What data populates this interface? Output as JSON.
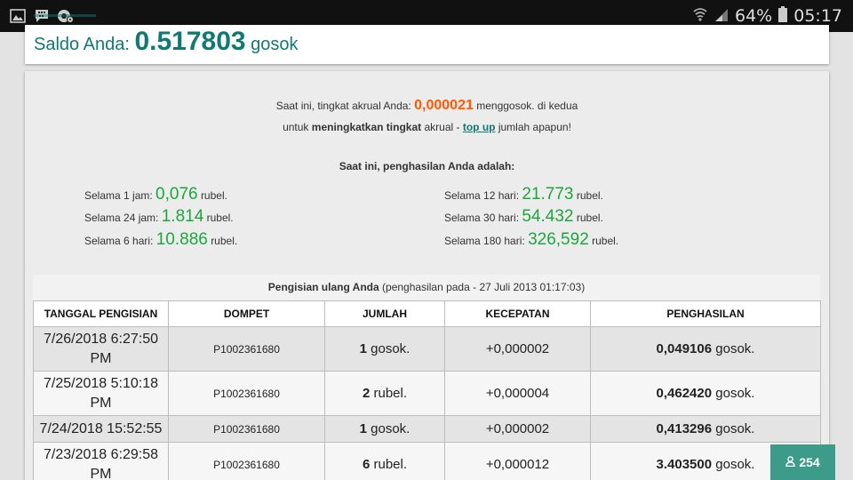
{
  "status_bar": {
    "battery": "64%",
    "time": "05:17"
  },
  "balance": {
    "label": "Saldo Anda:",
    "amount": "0.517803",
    "unit": "gosok"
  },
  "accrual": {
    "line1_prefix": "Saat ini, tingkat akrual Anda:",
    "rate": "0,000021",
    "line1_suffix": "menggosok. di kedua",
    "line2_prefix": "untuk",
    "line2_bold": "meningkatkan tingkat",
    "line2_mid": "akrual -",
    "line2_link": "top up",
    "line2_suffix": "jumlah apapun!"
  },
  "earnings": {
    "heading": "Saat ini, penghasilan Anda adalah:",
    "unit": "rubel.",
    "items": [
      {
        "label": "Selama 1 jam:",
        "value": "0,076"
      },
      {
        "label": "Selama 24 jam:",
        "value": "1.814"
      },
      {
        "label": "Selama 6 hari:",
        "value": "10.886"
      },
      {
        "label": "Selama 12 hari:",
        "value": "21.773"
      },
      {
        "label": "Selama 30 hari:",
        "value": "54.432"
      },
      {
        "label": "Selama 180 hari:",
        "value": "326,592"
      }
    ]
  },
  "deposits": {
    "caption_bold": "Pengisian ulang Anda",
    "caption_rest": "(penghasilan pada - 27 Juli 2013 01:17:03)",
    "columns": [
      "TANGGAL PENGISIAN",
      "DOMPET",
      "JUMLAH",
      "KECEPATAN",
      "PENGHASILAN"
    ],
    "rows": [
      {
        "date": "7/26/2018 6:27:50 PM",
        "wallet": "P1002361680",
        "amount": "1",
        "amount_unit": "gosok.",
        "speed": "+0,000002",
        "earned": "0,049106",
        "earned_unit": "gosok."
      },
      {
        "date": "7/25/2018 5:10:18 PM",
        "wallet": "P1002361680",
        "amount": "2",
        "amount_unit": "rubel.",
        "speed": "+0,000004",
        "earned": "0,462420",
        "earned_unit": "gosok."
      },
      {
        "date": "7/24/2018 15:52:55",
        "wallet": "P1002361680",
        "amount": "1",
        "amount_unit": "gosok.",
        "speed": "+0,000002",
        "earned": "0,413296",
        "earned_unit": "gosok."
      },
      {
        "date": "7/23/2018 6:29:58 PM",
        "wallet": "P1002361680",
        "amount": "6",
        "amount_unit": "rubel.",
        "speed": "+0,000012",
        "earned": "3.403500",
        "earned_unit": "gosok."
      }
    ]
  },
  "online_badge": {
    "icon": "user-icon",
    "count": "254"
  }
}
